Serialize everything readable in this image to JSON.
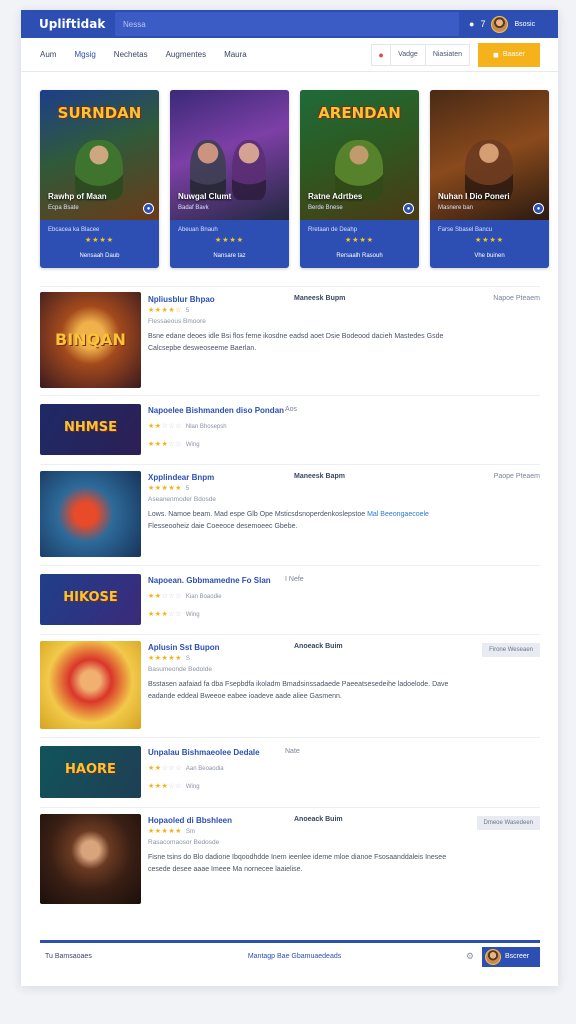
{
  "header": {
    "logo": "Upliftidak",
    "search_placeholder": "Nessa",
    "count": "7",
    "user": "Bsosic"
  },
  "nav": {
    "items": [
      "Aum",
      "Mgsig",
      "Nechetas",
      "Augmentes",
      "Maura"
    ],
    "active_index": 1,
    "btn_one": "Vadge",
    "btn_two": "Niasiaten",
    "cta": "Baaser"
  },
  "featured": [
    {
      "art_title": "SURNDAN",
      "name": "Rawhp of Maan",
      "sub": "Ecpa Bsate",
      "line": "Ebcacea ka Blacee",
      "stars": 3,
      "cta": "Nensaah Daub",
      "theme": "green"
    },
    {
      "art_title": "",
      "name": "Nuwgal Clumt",
      "sub": "Badaf Bavk",
      "line": "Abeuan Bnauh",
      "stars": 3,
      "cta": "Nansare taz",
      "theme": "purple"
    },
    {
      "art_title": "ARENDAN",
      "name": "Ratne Adrtbes",
      "sub": "Berde Bnese",
      "line": "Rretaan de Deahp",
      "stars": 3,
      "cta": "Rersaalh Rasouh",
      "theme": "jungle"
    },
    {
      "art_title": "",
      "name": "Nuhan I Dio Poneri",
      "sub": "Masnere ban",
      "line": "Farse Sbasel Bancu",
      "stars": 3,
      "cta": "Vhe buinen",
      "theme": "fire"
    }
  ],
  "list": [
    {
      "title": "Npliusblur Bhpao",
      "category": "Maneesk Bupm",
      "tag": "Napoe Pteaem",
      "rating": 4.5,
      "count": "5",
      "sub": "Flessaeous Bmoore",
      "desc": "Bsne edane deoes idle Bsi flos feme ikosdne eadsd aoet Dsie Bodeood dacieh Mastedes Gsde Calcsepbe desweoseeme Baerlan.",
      "art": "BINQAN"
    },
    {
      "title": "Napoelee Bishmanden diso Pondan",
      "hint": "Aos",
      "rating": 2,
      "count": "Nlan Bhosepsh",
      "stars2": 3,
      "sub2": "Wing",
      "art": "NHMSE"
    },
    {
      "title": "Xpplindear Bnpm",
      "category": "Maneesk Bapm",
      "tag": "Paope Pteaem",
      "rating": 5,
      "count": "5",
      "sub": "Aseanenmoder Bdosde",
      "desc_a": "Lows. Namoe beam. Mad espe Glb Ope Msticsdsnoperdenkoslepstoe ",
      "desc_link": "Mal Beeongaecoele",
      "desc_b": "Flesseooheiz daie Coeeoce desemoeec Gbebe.",
      "art": ""
    },
    {
      "title": "Napoean. Gbbmamedne Fo Slan",
      "hint": "I Nefe",
      "rating": 2,
      "count": "Kian Boaodie",
      "stars2": 3,
      "sub2": "Wing",
      "art": "HIKOSE"
    },
    {
      "title": "Aplusin Sst Bupon",
      "category": "Anoeack Buim",
      "chip": "Firone Weseaen",
      "rating": 5,
      "count": "S",
      "sub": "Basumeonde Bedolde",
      "desc": "Bsstasen aafaiad fa dba Fsepbdfa ikoladm Bmadsinssadaede Paeeatsesedeihe ladoelode. Dave eadande eddeal Bweeoe eabee ioadeve aade aliee Gasmenn.",
      "art": ""
    },
    {
      "title": "Unpalau Bishmaeolee Dedale",
      "hint": "Nate",
      "rating": 2,
      "count": "Aan Beoaodia",
      "stars2": 3,
      "sub2": "Wing",
      "art": "HAORE"
    },
    {
      "title": "Hopaoled di Bbshleen",
      "category": "Anoeack Buim",
      "chip": "Dmeoe Wasedeen",
      "rating": 5,
      "count": "Sm",
      "sub": "Rasacomaosor Bedosde",
      "desc": "Fisne tsins do Blo dadione Ibqoodhdde Inem ieenlee ideme mloe dianoe Fsosaanddaleis Inesee cesede desee aaae Imeee Ma nornecee laaielise.",
      "art": ""
    }
  ],
  "footer": {
    "left": "Tu  Bamsaoaes",
    "mid": "Mantagp Bae Gbamuaedeads",
    "user": "Bscreer"
  },
  "colors": {
    "brand": "#2d4fb3",
    "accent": "#f5b21a",
    "link": "#2d7ad1"
  }
}
